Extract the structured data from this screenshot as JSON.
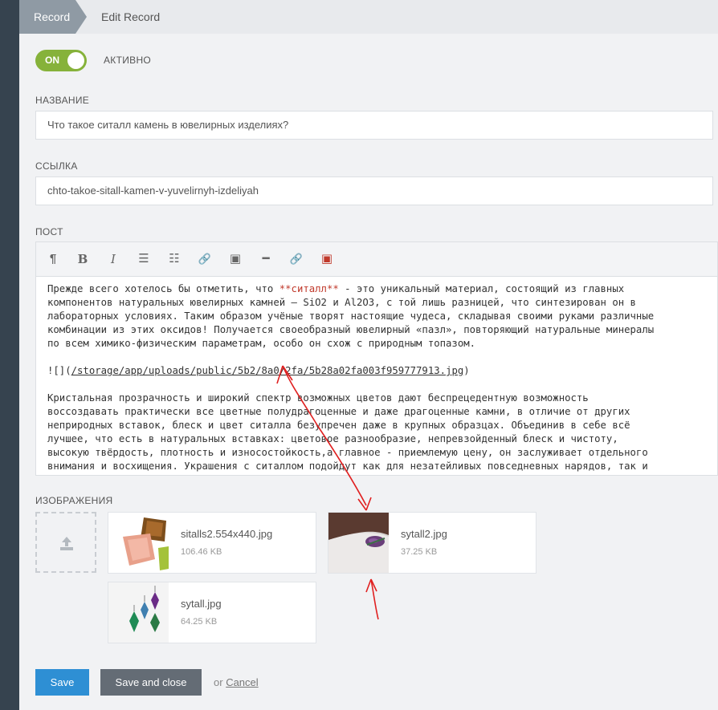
{
  "breadcrumb": {
    "active": "Record",
    "current": "Edit Record"
  },
  "toggle": {
    "state": "ON",
    "label": "АКТИВНО",
    "color": "#86b23a"
  },
  "fields": {
    "title": {
      "label": "НАЗВАНИЕ",
      "value": "Что такое ситалл камень в ювелирных изделиях?"
    },
    "slug": {
      "label": "ССЫЛКА",
      "value": "chto-takoe-sitall-kamen-v-yuvelirnyh-izdeliyah"
    },
    "post": {
      "label": "ПОСТ"
    }
  },
  "toolbar": {
    "items": [
      {
        "name": "paragraph",
        "glyph": "¶"
      },
      {
        "name": "bold",
        "glyph": "B"
      },
      {
        "name": "italic",
        "glyph": "I"
      },
      {
        "name": "unordered-list",
        "glyph": "☰"
      },
      {
        "name": "ordered-list",
        "glyph": "☷"
      },
      {
        "name": "link",
        "glyph": "🔗"
      },
      {
        "name": "image",
        "glyph": "▣"
      },
      {
        "name": "horizontal-rule",
        "glyph": "━"
      },
      {
        "name": "media-link",
        "glyph": "🔗"
      },
      {
        "name": "media-image",
        "glyph": "▣"
      }
    ]
  },
  "editor": {
    "p1_before": "Прежде всего хотелось бы отметить, что ",
    "p1_highlight": "**ситалл**",
    "p1_after": " - это уникальный материал, состоящий из главных",
    "p1_l2": "компонентов натуральных ювелирных камней — SiO2 и Al2O3, с той лишь разницей, что синтезирован он в",
    "p1_l3": "лабораторных условиях. Таким образом учёные творят настоящие чудеса, складывая своими руками различные",
    "p1_l4": "комбинации из этих оксидов! Получается своеобразный ювелирный «пазл», повторяющий натуральные минералы",
    "p1_l5": "по всем химико-физическим параметрам, особо он схож с природным топазом.",
    "img_prefix": "![](",
    "img_link": "/storage/app/uploads/public/5b2/8a0/2fa/5b28a02fa003f959777913.jpg",
    "img_suffix": ")",
    "p2_l1": "Кристальная прозрачность и широкий спектр возможных цветов дают беспрецедентную возможность",
    "p2_l2": "воссоздавать практически все цветные полудрагоценные и даже драгоценные камни, в отличие от других",
    "p2_l3": "неприродных вставок, блеск и цвет ситалла безупречен даже в крупных образцах. Объединив  в себе всё",
    "p2_l4": "лучшее, что есть в натуральных вставках: цветовое разнообразие, непревзойденный блеск и чистоту,",
    "p2_l5": "высокую твёрдость, плотность и износостойкость,а главное - приемлемую цену, он заслуживает отдельного",
    "p2_l6": "внимания и восхищения. Украшения с ситаллом подойдут как для незатейливых повседневных нарядов, так и"
  },
  "images": {
    "label": "ИЗОБРАЖЕНИЯ",
    "files": [
      {
        "name": "sitalls2.554x440.jpg",
        "size": "106.46 KB"
      },
      {
        "name": "sytall2.jpg",
        "size": "37.25 KB"
      },
      {
        "name": "sytall.jpg",
        "size": "64.25 KB"
      }
    ]
  },
  "actions": {
    "save": "Save",
    "save_close": "Save and close",
    "or": "or",
    "cancel": "Cancel"
  },
  "colors": {
    "primary": "#2e8fd4",
    "secondary": "#646c75",
    "annotation": "#e02020"
  }
}
